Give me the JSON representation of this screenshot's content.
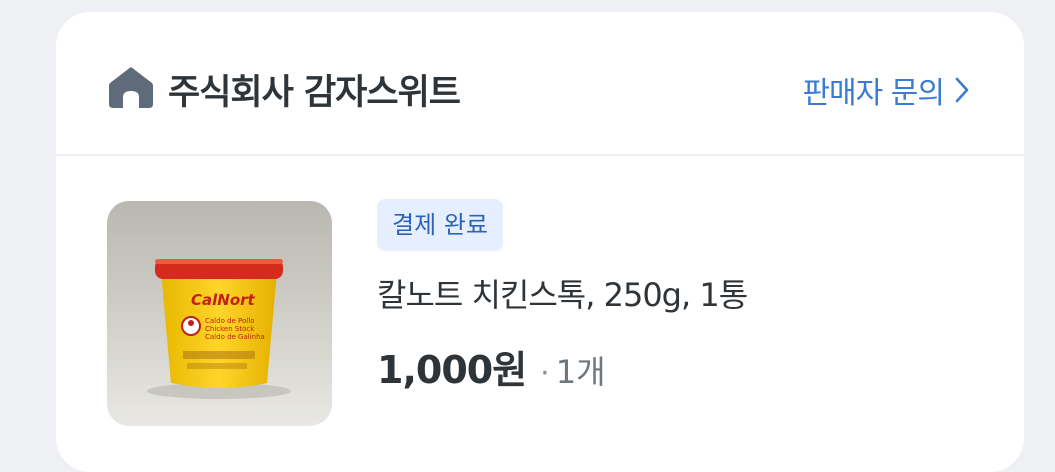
{
  "seller": {
    "icon": "home-icon",
    "name": "주식회사 감자스위트",
    "inquiry_label": "판매자 문의",
    "inquiry_icon": "chevron-right-icon"
  },
  "order": {
    "status_badge": "결제 완료",
    "product_name": "칼노트 치킨스톡, 250g, 1통",
    "price": "1,000원",
    "separator": "·",
    "quantity": "1개",
    "image": {
      "brand": "CalNort",
      "label_lines": [
        "Caldo de Pollo",
        "Chicken Stock",
        "Caldo de Galinha"
      ]
    }
  },
  "colors": {
    "accent": "#3a7bd5",
    "badge_bg": "#e5efff",
    "badge_text": "#2b62bd",
    "text_primary": "#2f3438",
    "icon_gray": "#5f6b7a"
  }
}
